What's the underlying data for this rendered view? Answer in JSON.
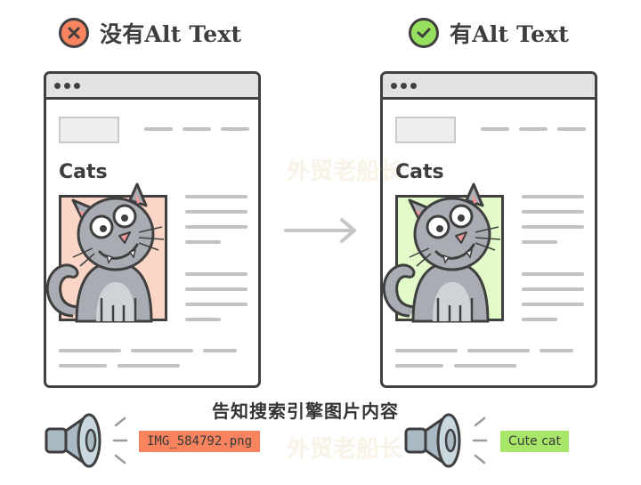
{
  "left_panel": {
    "heading": "没有Alt Text",
    "status_icon": "x-circle-icon",
    "status_color": "#f7845f",
    "page_heading": "Cats",
    "image_background": "#fbd5c5",
    "alt_text": "IMG_584792.png",
    "alt_text_background": "#f7845f"
  },
  "right_panel": {
    "heading": "有Alt Text",
    "status_icon": "check-circle-icon",
    "status_color": "#95e05d",
    "page_heading": "Cats",
    "image_background": "#e3fbc9",
    "alt_text": "Cute cat",
    "alt_text_background": "#a8e66a"
  },
  "arrow_icon": "arrow-right-icon",
  "caption": "告知搜索引擎图片内容",
  "speaker_icon": "speaker-icon",
  "watermark": {
    "text": "外贸老船长"
  }
}
